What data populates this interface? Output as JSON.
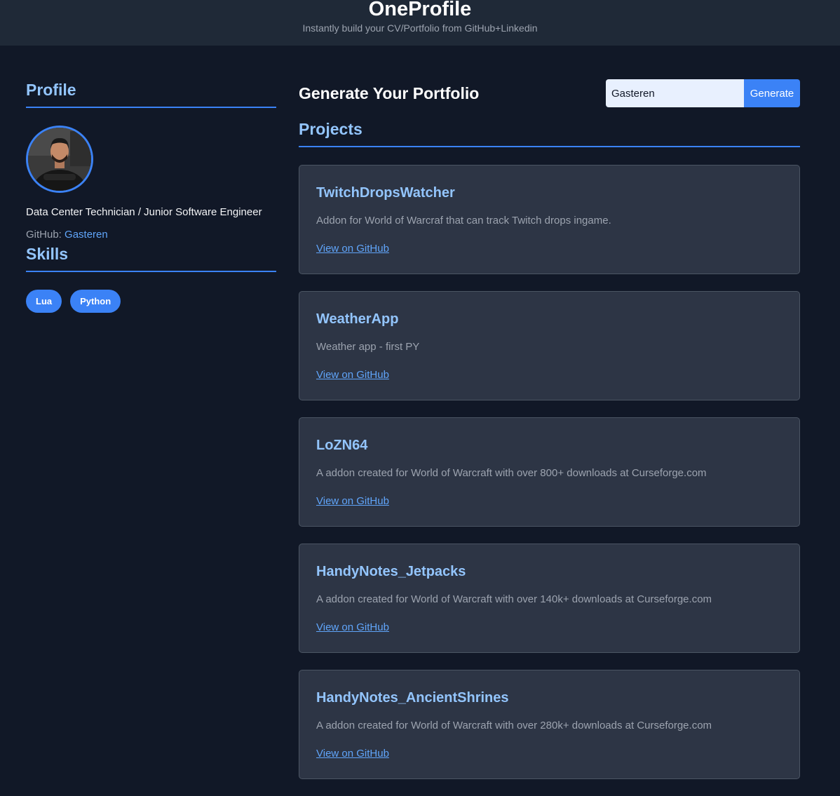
{
  "header": {
    "title": "OneProfile",
    "subtitle": "Instantly build your CV/Portfolio from GitHub+Linkedin"
  },
  "sidebar": {
    "profile_heading": "Profile",
    "role": "Data Center Technician / Junior Software Engineer",
    "github_label": "GitHub:",
    "github_user": "Gasteren",
    "skills_heading": "Skills",
    "skills": [
      "Lua",
      "Python"
    ]
  },
  "main": {
    "generate_title": "Generate Your Portfolio",
    "search": {
      "value": "Gasteren",
      "button_label": "Generate"
    },
    "projects_heading": "Projects",
    "projects": [
      {
        "name": "TwitchDropsWatcher",
        "description": "Addon for World of Warcraf that can track Twitch drops ingame.",
        "link_label": "View on GitHub"
      },
      {
        "name": "WeatherApp",
        "description": "Weather app - first PY",
        "link_label": "View on GitHub"
      },
      {
        "name": "LoZN64",
        "description": "A addon created for World of Warcraft with over 800+ downloads at Curseforge.com",
        "link_label": "View on GitHub"
      },
      {
        "name": "HandyNotes_Jetpacks",
        "description": "A addon created for World of Warcraft with over 140k+ downloads at Curseforge.com",
        "link_label": "View on GitHub"
      },
      {
        "name": "HandyNotes_AncientShrines",
        "description": "A addon created for World of Warcraft with over 280k+ downloads at Curseforge.com",
        "link_label": "View on GitHub"
      }
    ]
  },
  "colors": {
    "background": "#111827",
    "header": "#1f2937",
    "accent": "#3b82f6",
    "heading": "#93c5fd",
    "link": "#60a5fa",
    "card": "#2d3545"
  }
}
